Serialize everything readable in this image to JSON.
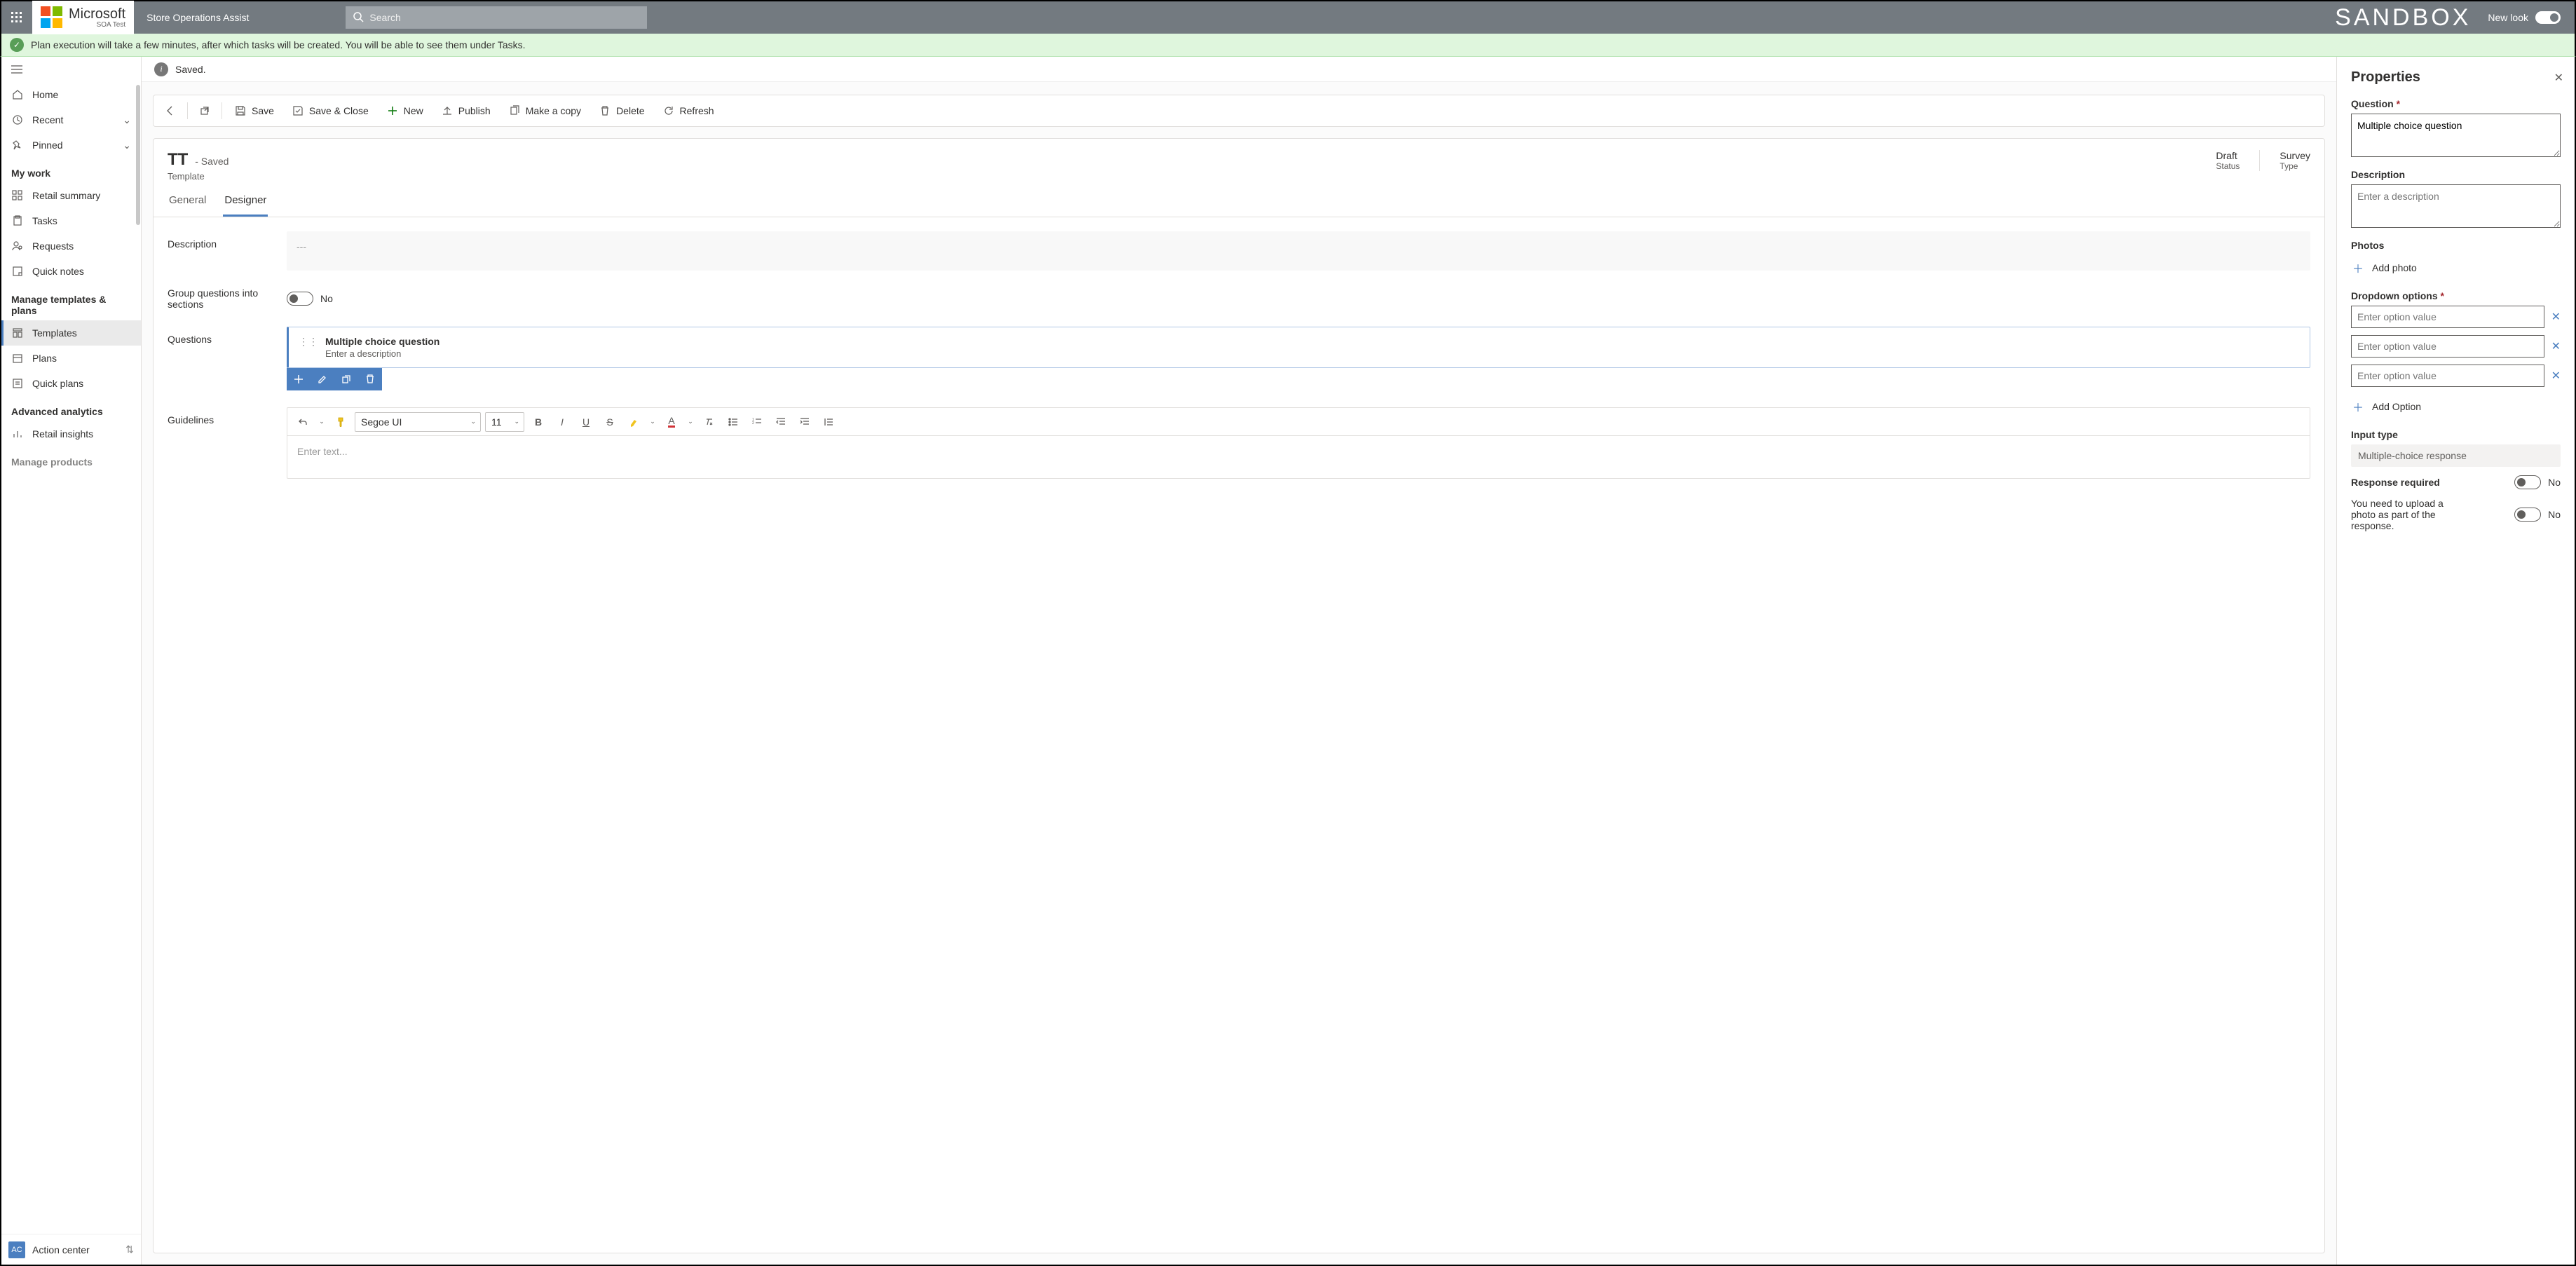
{
  "top": {
    "brand": "Microsoft",
    "brand_sub": "SOA Test",
    "app_name": "Store Operations Assist",
    "search_placeholder": "Search",
    "sandbox": "SANDBOX",
    "newlook": "New look"
  },
  "banner": {
    "text": "Plan execution will take a few minutes, after which tasks will be created. You will be able to see them under Tasks."
  },
  "saved_bar": {
    "text": "Saved."
  },
  "sidebar": {
    "home": "Home",
    "recent": "Recent",
    "pinned": "Pinned",
    "section1": "My work",
    "items1": [
      "Retail summary",
      "Tasks",
      "Requests",
      "Quick notes"
    ],
    "section2": "Manage templates & plans",
    "items2": [
      "Templates",
      "Plans",
      "Quick plans"
    ],
    "section3": "Advanced analytics",
    "items3": [
      "Retail insights"
    ],
    "section4": "Manage products",
    "action_center": "Action center",
    "ac_badge": "AC"
  },
  "commands": {
    "save": "Save",
    "save_close": "Save & Close",
    "new": "New",
    "publish": "Publish",
    "make_copy": "Make a copy",
    "delete": "Delete",
    "refresh": "Refresh"
  },
  "form_header": {
    "title": "TT",
    "saved": "- Saved",
    "subtitle": "Template",
    "meta": [
      {
        "value": "Draft",
        "label": "Status"
      },
      {
        "value": "Survey",
        "label": "Type"
      }
    ],
    "tabs": [
      "General",
      "Designer"
    ]
  },
  "form": {
    "description_label": "Description",
    "description_value": "---",
    "group_label": "Group questions into sections",
    "group_value": "No",
    "questions_label": "Questions",
    "question_title": "Multiple choice question",
    "question_desc": "Enter a description",
    "guidelines_label": "Guidelines",
    "rte": {
      "font": "Segoe UI",
      "size": "11",
      "placeholder": "Enter text..."
    }
  },
  "panel": {
    "title": "Properties",
    "question_label": "Question",
    "question_value": "Multiple choice question",
    "description_label": "Description",
    "description_placeholder": "Enter a description",
    "photos_label": "Photos",
    "add_photo": "Add photo",
    "dropdown_label": "Dropdown options",
    "option_placeholder": "Enter option value",
    "add_option": "Add Option",
    "input_type_label": "Input type",
    "input_type_value": "Multiple-choice response",
    "response_required_label": "Response required",
    "response_required_value": "No",
    "upload_photo_label": "You need to upload a photo as part of the response.",
    "upload_photo_value": "No"
  }
}
